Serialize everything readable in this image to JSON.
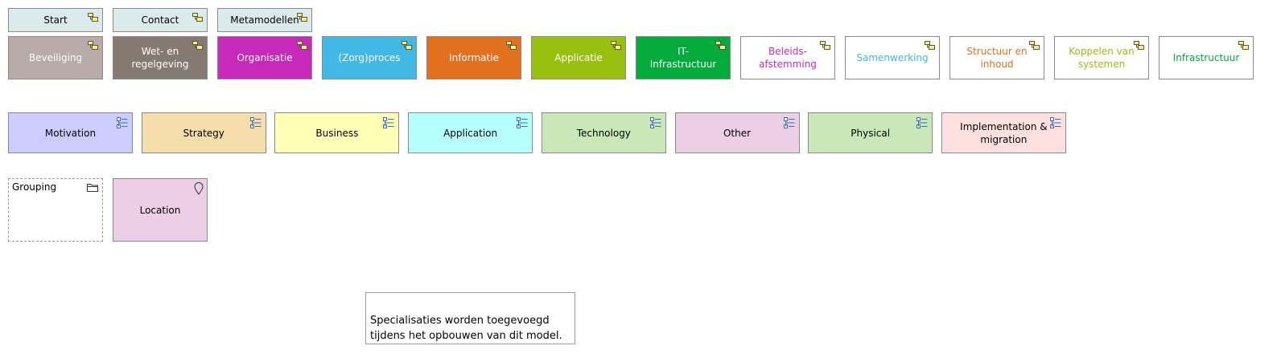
{
  "nav_buttons": [
    {
      "label": "Start",
      "icon": "diagram-model-icon"
    },
    {
      "label": "Contact",
      "icon": "diagram-model-icon"
    },
    {
      "label": "Metamodellen",
      "icon": "diagram-model-icon"
    }
  ],
  "layer_views": [
    {
      "label": "Beveiliging",
      "fill": "#b7aca7",
      "text": "#ffffff"
    },
    {
      "label": "Wet- en\nregelgeving",
      "fill": "#857a72",
      "text": "#ffffff"
    },
    {
      "label": "Organisatie",
      "fill": "#c72abb",
      "text": "#ffffff"
    },
    {
      "label": "(Zorg)proces",
      "fill": "#41b8e6",
      "text": "#ffffff"
    },
    {
      "label": "Informatie",
      "fill": "#e3701e",
      "text": "#ffffff"
    },
    {
      "label": "Applicatie",
      "fill": "#99bf10",
      "text": "#ffffff"
    },
    {
      "label": "IT-Infrastructuur",
      "fill": "#03ab3c",
      "text": "#ffffff"
    },
    {
      "label": "Beleids-\nafstemming",
      "fill": "#ffffff",
      "text": "#c72abb"
    },
    {
      "label": "Samenwerking",
      "fill": "#ffffff",
      "text": "#41b8e6"
    },
    {
      "label": "Structuur en\ninhoud",
      "fill": "#ffffff",
      "text": "#e3701e"
    },
    {
      "label": "Koppelen van\nsystemen",
      "fill": "#ffffff",
      "text": "#99bf10"
    },
    {
      "label": "Infrastructuur",
      "fill": "#ffffff",
      "text": "#03ab3c"
    }
  ],
  "element_views": [
    {
      "label": "Motivation",
      "fill": "#ccccff"
    },
    {
      "label": "Strategy",
      "fill": "#f5deaa"
    },
    {
      "label": "Business",
      "fill": "#ffffb5"
    },
    {
      "label": "Application",
      "fill": "#b5ffff"
    },
    {
      "label": "Technology",
      "fill": "#c9e7b7"
    },
    {
      "label": "Other",
      "fill": "#eccfe4"
    },
    {
      "label": "Physical",
      "fill": "#c9e7b7"
    },
    {
      "label": "Implementation &\nmigration",
      "fill": "#ffe0e0"
    }
  ],
  "grouping": {
    "label": "Grouping"
  },
  "location": {
    "label": "Location",
    "fill": "#eccfe4"
  },
  "note": {
    "text": "Specialisaties worden toegevoegd\ntijdens het opbouwen van dit model."
  },
  "colors": {
    "nav_fill": "#dbebeb",
    "border": "#8a8a8a"
  }
}
